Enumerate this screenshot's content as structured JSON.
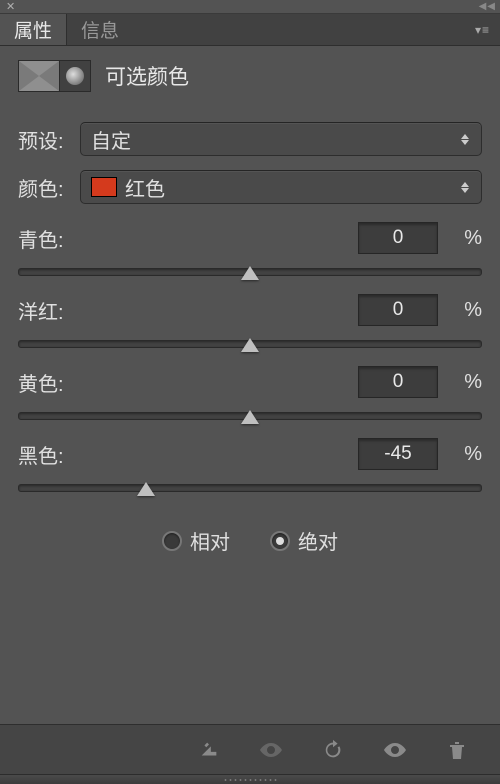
{
  "tabs": {
    "properties": "属性",
    "info": "信息"
  },
  "title": "可选颜色",
  "preset": {
    "label": "预设:",
    "value": "自定"
  },
  "color": {
    "label": "颜色:",
    "value": "红色",
    "swatch": "#d43a1d"
  },
  "channels": [
    {
      "label": "青色:",
      "value": "0",
      "pct": "%",
      "pos": 50
    },
    {
      "label": "洋红:",
      "value": "0",
      "pct": "%",
      "pos": 50
    },
    {
      "label": "黄色:",
      "value": "0",
      "pct": "%",
      "pos": 50
    },
    {
      "label": "黑色:",
      "value": "-45",
      "pct": "%",
      "pos": 27.5
    }
  ],
  "mode": {
    "relative": "相对",
    "absolute": "绝对",
    "selected": "absolute"
  }
}
